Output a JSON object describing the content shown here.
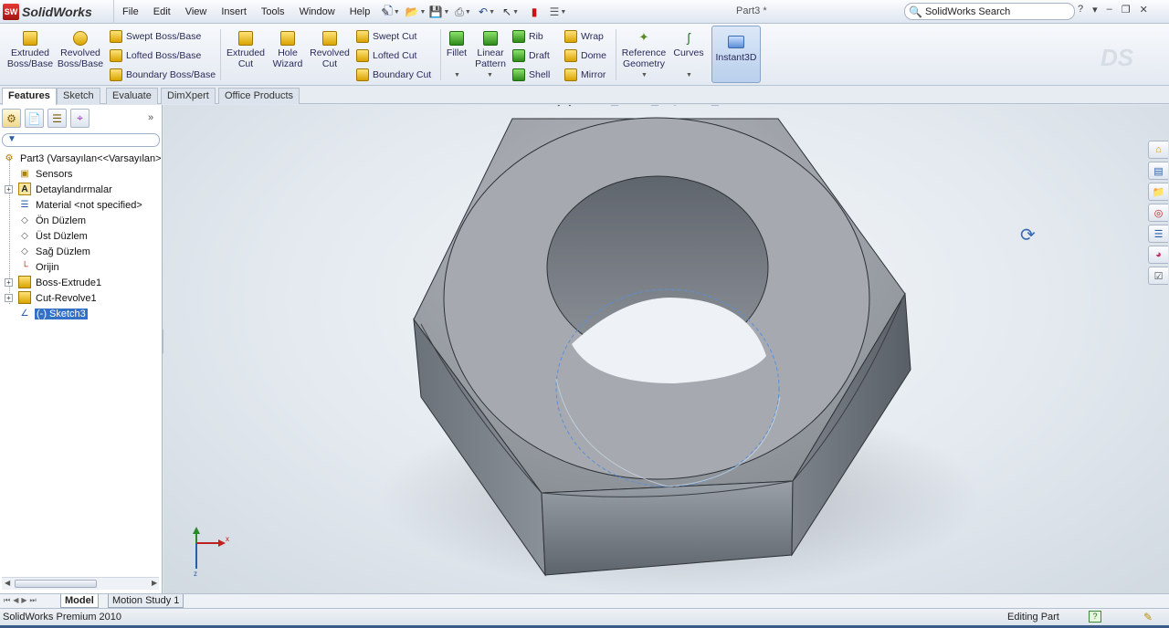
{
  "app": {
    "logo_text": "SolidWorks",
    "logo_mark": "SW",
    "document_title": "Part3 *",
    "menu": [
      "File",
      "Edit",
      "View",
      "Insert",
      "Tools",
      "Window",
      "Help"
    ],
    "search_placeholder": "SolidWorks Search",
    "ds_watermark": "DS"
  },
  "ribbon": {
    "extruded_boss": "Extruded Boss/Base",
    "revolved_boss": "Revolved Boss/Base",
    "swept_boss": "Swept Boss/Base",
    "lofted_boss": "Lofted Boss/Base",
    "boundary_boss": "Boundary Boss/Base",
    "extruded_cut": "Extruded Cut",
    "hole_wizard": "Hole Wizard",
    "revolved_cut": "Revolved Cut",
    "swept_cut": "Swept Cut",
    "lofted_cut": "Lofted Cut",
    "boundary_cut": "Boundary Cut",
    "fillet": "Fillet",
    "linear_pattern": "Linear Pattern",
    "rib": "Rib",
    "draft": "Draft",
    "shell": "Shell",
    "wrap": "Wrap",
    "dome": "Dome",
    "mirror": "Mirror",
    "reference_geometry": "Reference Geometry",
    "curves": "Curves",
    "instant3d": "Instant3D"
  },
  "command_tabs": [
    "Features",
    "Sketch",
    "Evaluate",
    "DimXpert",
    "Office Products"
  ],
  "feature_tree": {
    "root": "Part3  (Varsayılan<<Varsayılan>",
    "items": [
      {
        "label": "Sensors",
        "icon": "sensor-icon"
      },
      {
        "label": "Detaylandırmalar",
        "icon": "annotations-icon"
      },
      {
        "label": "Material <not specified>",
        "icon": "material-icon"
      },
      {
        "label": "Ön Düzlem",
        "icon": "plane-icon"
      },
      {
        "label": "Üst Düzlem",
        "icon": "plane-icon"
      },
      {
        "label": "Sağ Düzlem",
        "icon": "plane-icon"
      },
      {
        "label": "Orijin",
        "icon": "origin-icon"
      },
      {
        "label": "Boss-Extrude1",
        "icon": "extrude-icon"
      },
      {
        "label": "Cut-Revolve1",
        "icon": "revolve-cut-icon"
      },
      {
        "label": "(-) Sketch3",
        "icon": "sketch-icon"
      }
    ]
  },
  "bottom_tabs": [
    "Model",
    "Motion Study 1"
  ],
  "status": {
    "left": "SolidWorks Premium 2010",
    "right": "Editing Part",
    "help": "?"
  },
  "colors": {
    "nut_face": "#8e939a",
    "nut_top": "#a9adb3",
    "selection": "#3370c8",
    "viewport_bg": "#e3e9ef"
  }
}
